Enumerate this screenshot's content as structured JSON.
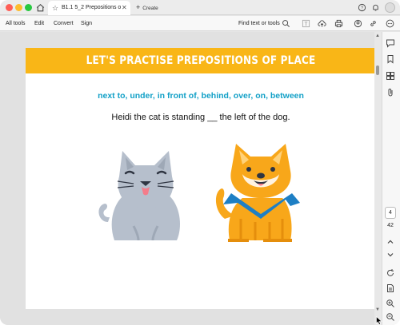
{
  "tab": {
    "title": "B1.1 5_2 Prepositions of..."
  },
  "new_tab": {
    "label": "Create"
  },
  "toolbar": {
    "menu": [
      "All tools",
      "Edit",
      "Convert",
      "Sign"
    ],
    "find_label": "Find text or tools"
  },
  "document": {
    "banner": "LET'S PRACTISE PREPOSITIONS OF PLACE",
    "prepositions": "next to, under, in front of, behind, over, on, between",
    "sentence": "Heidi the cat is standing __ the left of the dog."
  },
  "navigation": {
    "current_page": "4",
    "total_pages": "42"
  },
  "colors": {
    "banner": "#f9b617",
    "prepositions": "#12a0c7",
    "cat": "#b6bfcc",
    "dog": "#f8a71a"
  }
}
